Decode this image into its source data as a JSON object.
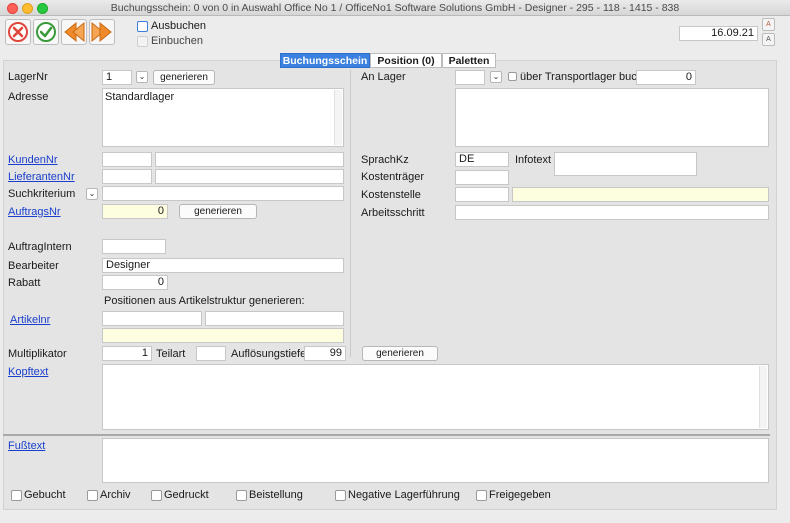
{
  "window": {
    "title": "Buchungsschein: 0 von 0 in Auswahl Office No 1 /  OfficeNo1 Software Solutions GmbH - Designer - 295 - 118 - 1415 - 838"
  },
  "toolbar": {
    "ausbuchen_label": "Ausbuchen",
    "einbuchen_label": "Einbuchen",
    "date": "16.09.21"
  },
  "tabs": [
    {
      "label": "Buchungsschein"
    },
    {
      "label": "Position (0)"
    },
    {
      "label": "Paletten"
    }
  ],
  "left": {
    "lagernr_label": "LagerNr",
    "lagernr_value": "1",
    "generieren": "generieren",
    "adresse_label": "Adresse",
    "adresse_value": "Standardlager",
    "kundennr_label": "KundenNr",
    "lieferantennr_label": "LieferantenNr",
    "suchkriterium_label": "Suchkriterium",
    "auftragsnr_label": "AuftragsNr",
    "auftragsnr_value": "0",
    "auftragintern_label": "AuftragIntern",
    "bearbeiter_label": "Bearbeiter",
    "bearbeiter_value": "Designer",
    "rabatt_label": "Rabatt",
    "rabatt_value": "0",
    "positionen_label": "Positionen aus Artikelstruktur generieren:",
    "artikelnr_label": "Artikelnr",
    "multiplikator_label": "Multiplikator",
    "multiplikator_value": "1",
    "teilart_label": "Teilart",
    "aufloesungstiefe_label": "Auflösungstiefe",
    "aufloesungstiefe_value": "99",
    "kopftext_label": "Kopftext",
    "fusstext_label": "Fußtext"
  },
  "right": {
    "anlager_label": "An Lager",
    "transportlager_label": "über Transportlager buchen",
    "transportlager_value": "0",
    "sprachkz_label": "SprachKz",
    "sprachkz_value": "DE",
    "infotext_label": "Infotext",
    "kostentraeger_label": "Kostenträger",
    "kostenstelle_label": "Kostenstelle",
    "arbeitsschritt_label": "Arbeitsschritt"
  },
  "footer_checks": [
    {
      "label": "Gebucht"
    },
    {
      "label": "Archiv"
    },
    {
      "label": "Gedruckt"
    },
    {
      "label": "Beistellung"
    },
    {
      "label": "Negative Lagerführung"
    },
    {
      "label": "Freigegeben"
    }
  ],
  "colors": {
    "accent": "#3b82e0",
    "link": "#1a3fcc",
    "highlight_field": "#fdfde0",
    "cancel": "#e0463c",
    "confirm": "#3a9a3a",
    "nav": "#f08a2b"
  }
}
